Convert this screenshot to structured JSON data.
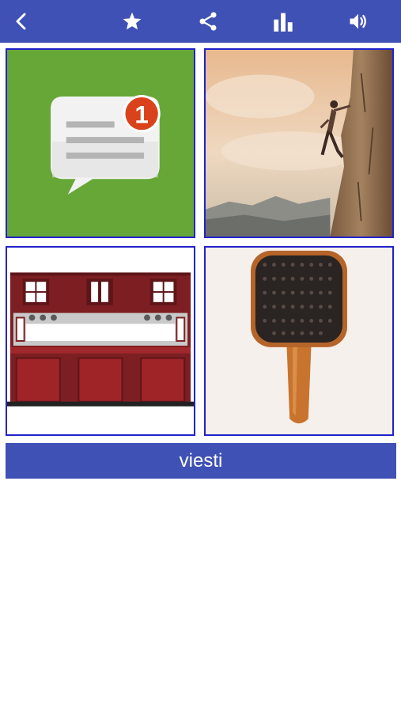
{
  "toolbar": {
    "buttons": [
      {
        "name": "back",
        "icon": "chevron-left-icon"
      },
      {
        "name": "favorite",
        "icon": "star-icon"
      },
      {
        "name": "share",
        "icon": "share-icon"
      },
      {
        "name": "stats",
        "icon": "bar-chart-icon"
      },
      {
        "name": "sound",
        "icon": "volume-icon"
      }
    ],
    "color": "#3f51b5"
  },
  "tiles": [
    {
      "name": "tile-message",
      "picture": "message-notification-icon",
      "badge": "1"
    },
    {
      "name": "tile-climber",
      "picture": "rock-climber-photo"
    },
    {
      "name": "tile-building",
      "picture": "building-facade-image"
    },
    {
      "name": "tile-hairbrush",
      "picture": "hairbrush-photo"
    }
  ],
  "answer": {
    "text": "viesti"
  },
  "colors": {
    "accent": "#3f51b5",
    "tile_border": "#2222cc",
    "text_on_accent": "#ffffff"
  }
}
